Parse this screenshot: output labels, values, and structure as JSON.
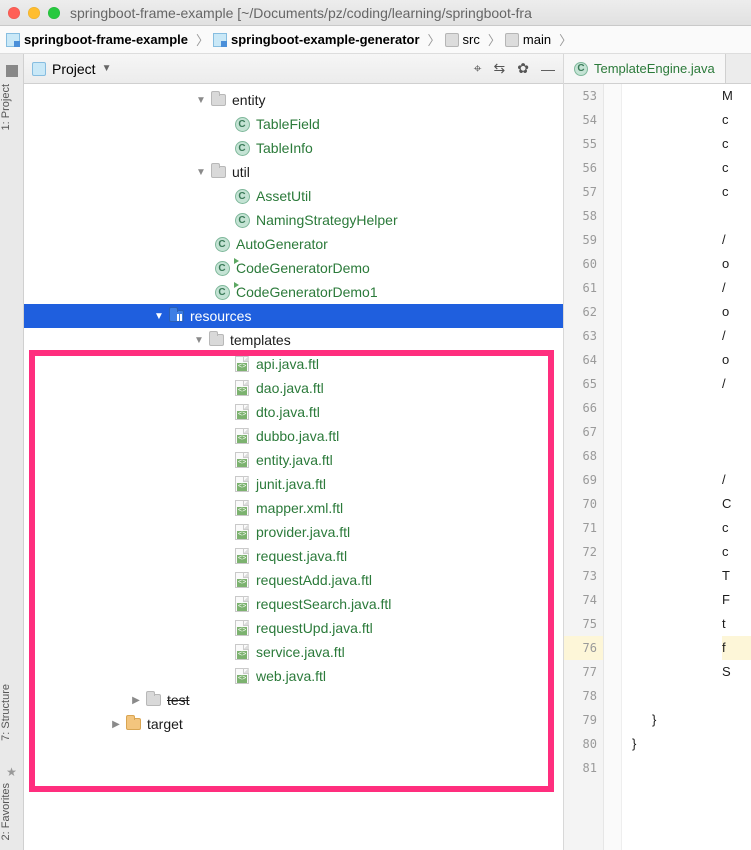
{
  "window": {
    "title": "springboot-frame-example [~/Documents/pz/coding/learning/springboot-fra"
  },
  "breadcrumbs": {
    "items": [
      "springboot-frame-example",
      "springboot-example-generator",
      "src",
      "main"
    ]
  },
  "sidetabs": {
    "project": "1: Project",
    "structure": "7: Structure",
    "favorites": "2: Favorites"
  },
  "ptoolbar": {
    "view": "Project"
  },
  "tree": {
    "entity": {
      "label": "entity",
      "children": [
        "TableField",
        "TableInfo"
      ]
    },
    "util": {
      "label": "util",
      "children": [
        "AssetUtil",
        "NamingStrategyHelper"
      ]
    },
    "loose": [
      "AutoGenerator",
      "CodeGeneratorDemo",
      "CodeGeneratorDemo1"
    ],
    "resources": "resources",
    "templates": "templates",
    "ftl": [
      "api.java.ftl",
      "dao.java.ftl",
      "dto.java.ftl",
      "dubbo.java.ftl",
      "entity.java.ftl",
      "junit.java.ftl",
      "mapper.xml.ftl",
      "provider.java.ftl",
      "request.java.ftl",
      "requestAdd.java.ftl",
      "requestSearch.java.ftl",
      "requestUpd.java.ftl",
      "service.java.ftl",
      "web.java.ftl"
    ],
    "test": "test",
    "target": "target"
  },
  "editor": {
    "tab": "TemplateEngine.java",
    "lines": [
      "53",
      "54",
      "55",
      "56",
      "57",
      "58",
      "59",
      "60",
      "61",
      "62",
      "63",
      "64",
      "65",
      "66",
      "67",
      "68",
      "69",
      "70",
      "71",
      "72",
      "73",
      "74",
      "75",
      "76",
      "77",
      "78",
      "79",
      "80",
      "81"
    ],
    "code": [
      "M",
      "c",
      "c",
      "c",
      "c",
      "",
      "/",
      "o",
      "/",
      "o",
      "/",
      "o",
      "/",
      "",
      "",
      "",
      "/",
      "C",
      "c",
      "c",
      "T",
      "F",
      "t",
      "f",
      "S",
      "",
      "    }",
      "}",
      ""
    ]
  }
}
